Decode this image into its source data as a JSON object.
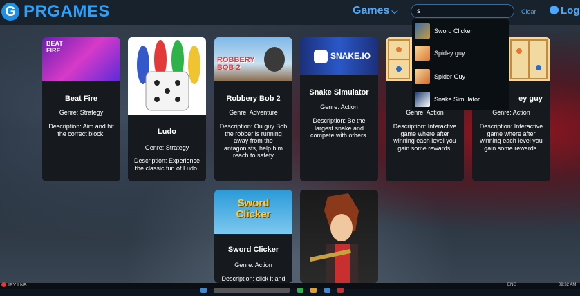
{
  "header": {
    "logo_text": "PRGAMES",
    "logo_glyph": "G",
    "games_label": "Games",
    "search_value": "s",
    "clear_label": "Clear",
    "login_label": "Log"
  },
  "dropdown": {
    "items": [
      {
        "label": "Sword Clicker"
      },
      {
        "label": "Spidey guy"
      },
      {
        "label": "Spider Guy"
      },
      {
        "label": "Snake Simulator"
      }
    ]
  },
  "cards": [
    {
      "title": "Beat Fire",
      "genre": "Genre: Strategy",
      "description": "Description: Aim and hit the correct block.",
      "thumb_text": "BEAT FIRE"
    },
    {
      "title": "Ludo",
      "genre": "Genre: Strategy",
      "description": "Description: Experience the classic fun of Ludo."
    },
    {
      "title": "Robbery Bob 2",
      "genre": "Genre: Adventure",
      "description": "Description: Ou guy Bob the robber is running away from the antagonists, help him reach to safety",
      "thumb_text": "ROBBERY BOB 2"
    },
    {
      "title": "Snake Simulator",
      "genre": "Genre: Action",
      "description": "Description: Be the largest snake and compete with others.",
      "thumb_text": "SNAKE.IO"
    },
    {
      "title": "Sp",
      "genre": "Genre: Action",
      "description": "Description: Interactive game where after winning each level you gain some rewards."
    },
    {
      "title": "ey guy",
      "genre": "Genre: Action",
      "description": "Description: Interactive game where after winning each level you gain some rewards."
    },
    {
      "title": "Sword Clicker",
      "genre": "Genre: Action",
      "description": "Description: click it and",
      "thumb_text": "Sword Clicker"
    },
    {
      "title": "",
      "genre": "",
      "description": ""
    }
  ],
  "taskbar": {
    "user_label": "IPY LNB",
    "lang_label": "ENG",
    "time_label": "09:32 AM"
  },
  "colors": {
    "accent": "#4aa8ff",
    "logo": "#2aa0ff",
    "navbar": "#17222d",
    "card": "#16191d"
  }
}
